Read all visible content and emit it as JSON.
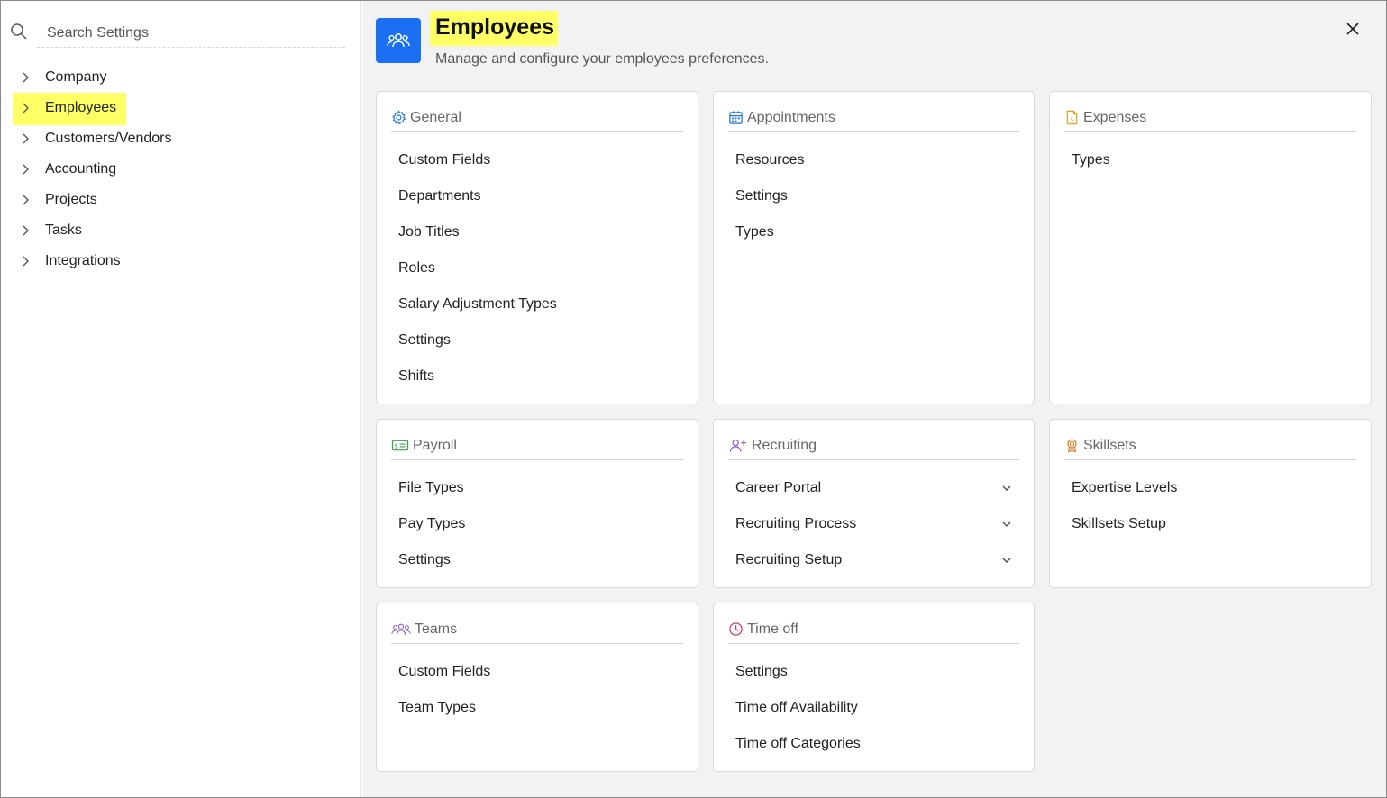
{
  "search": {
    "placeholder": "Search Settings"
  },
  "nav": {
    "items": [
      {
        "label": "Company"
      },
      {
        "label": "Employees"
      },
      {
        "label": "Customers/Vendors"
      },
      {
        "label": "Accounting"
      },
      {
        "label": "Projects"
      },
      {
        "label": "Tasks"
      },
      {
        "label": "Integrations"
      }
    ],
    "active": "Employees"
  },
  "header": {
    "title": "Employees",
    "subtitle": "Manage and configure your employees preferences.",
    "icon": "people-icon",
    "icon_bg": "#1a6ff2"
  },
  "cards": {
    "general": {
      "title": "General",
      "icon": "gear-icon",
      "icon_color": "#1a6ff2",
      "items": [
        "Custom Fields",
        "Departments",
        "Job Titles",
        "Roles",
        "Salary Adjustment Types",
        "Settings",
        "Shifts"
      ]
    },
    "appointments": {
      "title": "Appointments",
      "icon": "calendar-icon",
      "icon_color": "#1a6ff2",
      "items": [
        "Resources",
        "Settings",
        "Types"
      ]
    },
    "expenses": {
      "title": "Expenses",
      "icon": "receipt-icon",
      "icon_color": "#e8a020",
      "items": [
        "Types"
      ]
    },
    "payroll": {
      "title": "Payroll",
      "icon": "payroll-card-icon",
      "icon_color": "#2aa84a",
      "items": [
        "File Types",
        "Pay Types",
        "Settings"
      ]
    },
    "recruiting": {
      "title": "Recruiting",
      "icon": "user-plus-icon",
      "icon_color": "#8a5cd6",
      "items": [
        "Career Portal",
        "Recruiting Process",
        "Recruiting Setup"
      ]
    },
    "skillsets": {
      "title": "Skillsets",
      "icon": "award-icon",
      "icon_color": "#e8731a",
      "items": [
        "Expertise Levels",
        "Skillsets Setup"
      ]
    },
    "teams": {
      "title": "Teams",
      "icon": "team-icon",
      "icon_color": "#8a5cd6",
      "items": [
        "Custom Fields",
        "Team Types"
      ]
    },
    "timeoff": {
      "title": "Time off",
      "icon": "clock-icon",
      "icon_color": "#d6336c",
      "items": [
        "Settings",
        "Time off Availability",
        "Time off Categories"
      ]
    }
  },
  "highlight_color": "#ffff66"
}
